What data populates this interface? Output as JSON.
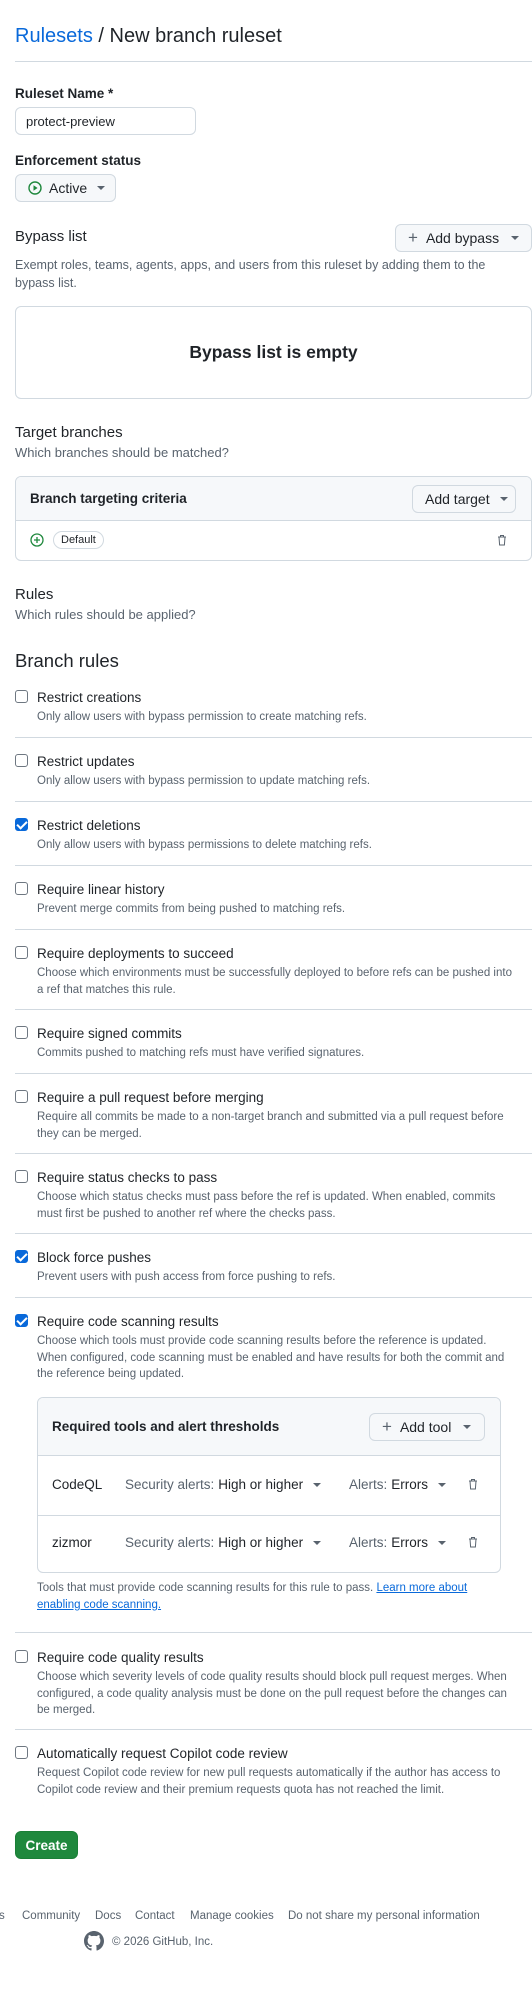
{
  "breadcrumb": {
    "root": "Rulesets",
    "separator": "/",
    "current": "New branch ruleset"
  },
  "ruleset_name": {
    "label": "Ruleset Name *",
    "value": "protect-preview"
  },
  "enforcement": {
    "label": "Enforcement status",
    "value": "Active"
  },
  "bypass": {
    "title": "Bypass list",
    "add_label": "Add bypass",
    "description": "Exempt roles, teams, agents, apps, and users from this ruleset by adding them to the bypass list.",
    "empty": "Bypass list is empty"
  },
  "targets": {
    "title": "Target branches",
    "subtitle": "Which branches should be matched?",
    "criteria_label": "Branch targeting criteria",
    "add_label": "Add target",
    "items": [
      "Default"
    ]
  },
  "rules": {
    "title": "Rules",
    "subtitle": "Which rules should be applied?"
  },
  "branch_rules": {
    "title": "Branch rules",
    "items": [
      {
        "title": "Restrict creations",
        "desc": "Only allow users with bypass permission to create matching refs.",
        "checked": false
      },
      {
        "title": "Restrict updates",
        "desc": "Only allow users with bypass permission to update matching refs.",
        "checked": false
      },
      {
        "title": "Restrict deletions",
        "desc": "Only allow users with bypass permissions to delete matching refs.",
        "checked": true
      },
      {
        "title": "Require linear history",
        "desc": "Prevent merge commits from being pushed to matching refs.",
        "checked": false
      },
      {
        "title": "Require deployments to succeed",
        "desc": "Choose which environments must be successfully deployed to before refs can be pushed into a ref that matches this rule.",
        "checked": false
      },
      {
        "title": "Require signed commits",
        "desc": "Commits pushed to matching refs must have verified signatures.",
        "checked": false
      },
      {
        "title": "Require a pull request before merging",
        "desc": "Require all commits be made to a non-target branch and submitted via a pull request before they can be merged.",
        "checked": false
      },
      {
        "title": "Require status checks to pass",
        "desc": "Choose which status checks must pass before the ref is updated. When enabled, commits must first be pushed to another ref where the checks pass.",
        "checked": false
      },
      {
        "title": "Block force pushes",
        "desc": "Prevent users with push access from force pushing to refs.",
        "checked": true
      },
      {
        "title": "Require code scanning results",
        "desc": "Choose which tools must provide code scanning results before the reference is updated. When configured, code scanning must be enabled and have results for both the commit and the reference being updated.",
        "checked": true
      },
      {
        "title": "Require code quality results",
        "desc": "Choose which severity levels of code quality results should block pull request merges. When configured, a code quality analysis must be done on the pull request before the changes can be merged.",
        "checked": false
      },
      {
        "title": "Automatically request Copilot code review",
        "desc": "Request Copilot code review for new pull requests automatically if the author has access to Copilot code review and their premium requests quota has not reached the limit.",
        "checked": false
      }
    ]
  },
  "code_scanning": {
    "header": "Required tools and alert thresholds",
    "add_label": "Add tool",
    "tools": [
      {
        "name": "CodeQL",
        "sec_label": "Security alerts:",
        "sec_value": "High or higher",
        "alerts_label": "Alerts:",
        "alerts_value": "Errors"
      },
      {
        "name": "zizmor",
        "sec_label": "Security alerts:",
        "sec_value": "High or higher",
        "alerts_label": "Alerts:",
        "alerts_value": "Errors"
      }
    ],
    "note": "Tools that must provide code scanning results for this rule to pass.",
    "learn_more": "Learn more about enabling code scanning."
  },
  "create_label": "Create",
  "footer": {
    "links": [
      "Community",
      "Docs",
      "Contact",
      "Manage cookies",
      "Do not share my personal information"
    ],
    "partial": "s",
    "copyright": "© 2026 GitHub, Inc."
  },
  "colors": {
    "accent": "#0969da",
    "success": "#1f883d",
    "border": "#d1d9e0"
  }
}
